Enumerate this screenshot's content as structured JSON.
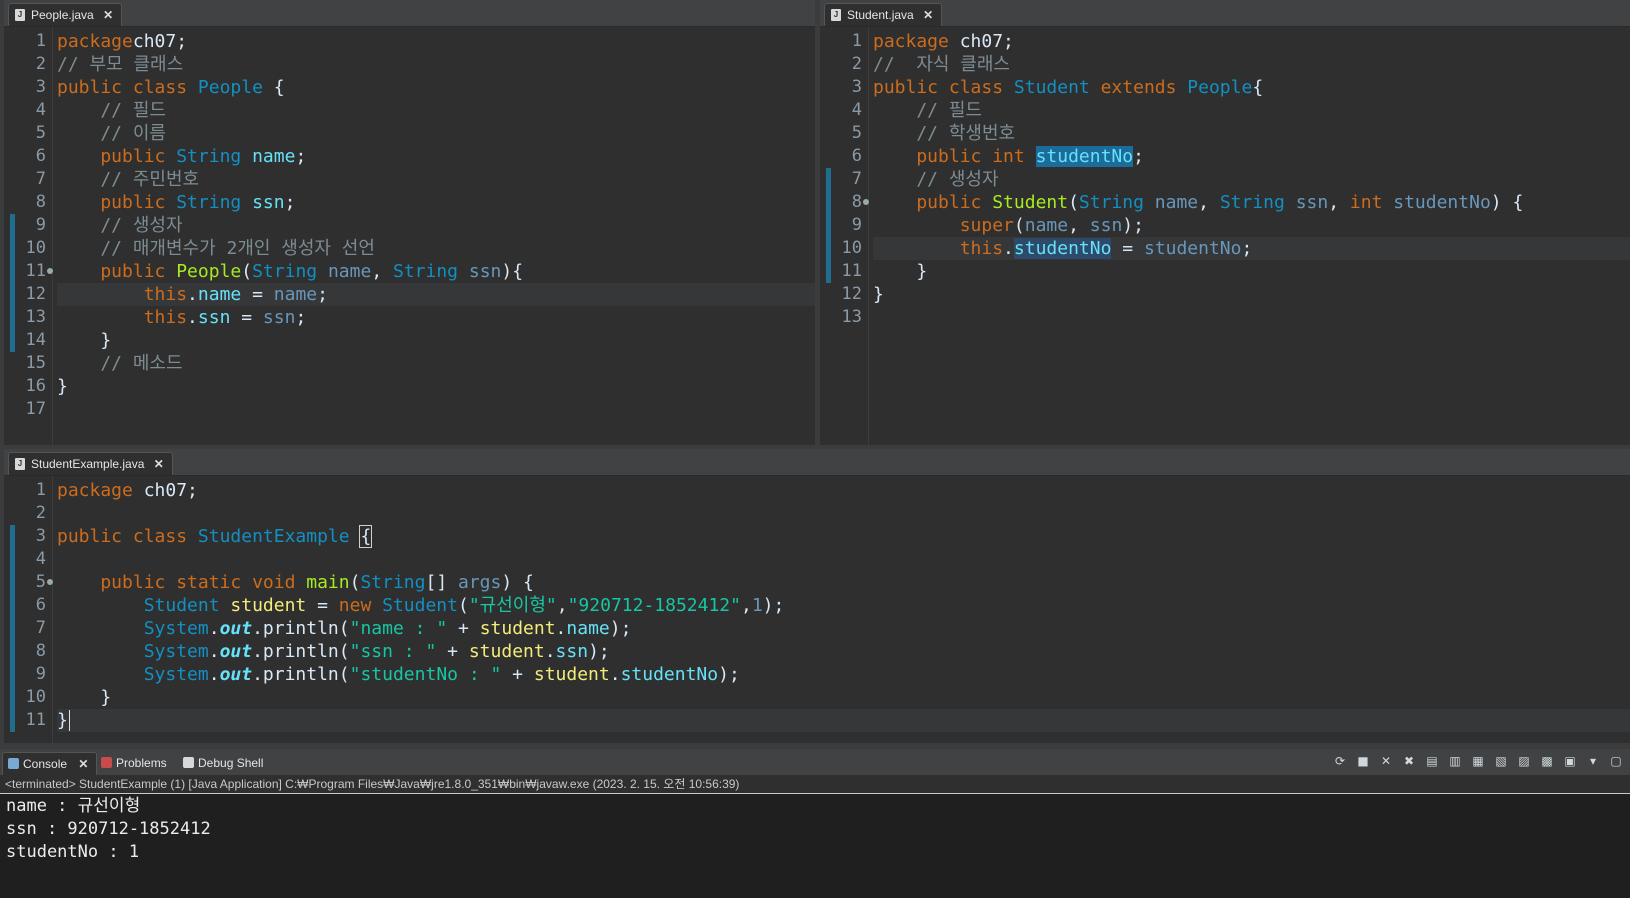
{
  "editors": {
    "people": {
      "tab_label": "People.java",
      "file_icon": "java-file-icon",
      "line_numbers": [
        "1",
        "2",
        "3",
        "4",
        "5",
        "6",
        "7",
        "8",
        "9",
        "10",
        "11",
        "12",
        "13",
        "14",
        "15",
        "16",
        "17"
      ]
    },
    "student": {
      "tab_label": "Student.java",
      "file_icon": "java-file-icon",
      "line_numbers": [
        "1",
        "2",
        "3",
        "4",
        "5",
        "6",
        "7",
        "8",
        "9",
        "10",
        "11",
        "12",
        "13"
      ]
    },
    "example": {
      "tab_label": "StudentExample.java",
      "file_icon": "java-file-icon",
      "line_numbers": [
        "1",
        "2",
        "3",
        "4",
        "5",
        "6",
        "7",
        "8",
        "9",
        "10",
        "11"
      ]
    }
  },
  "code": {
    "people": [
      [
        [
          "k",
          "package"
        ],
        [
          "",
          "ch07;"
        ]
      ],
      [
        [
          "c",
          "// 부모 클래스"
        ]
      ],
      [
        [
          "k",
          "public class "
        ],
        [
          "t",
          "People"
        ],
        [
          "",
          " {"
        ]
      ],
      [
        [
          "c",
          "    // 필드"
        ]
      ],
      [
        [
          "c",
          "    // 이름"
        ]
      ],
      [
        [
          "k",
          "    public "
        ],
        [
          "t",
          "String "
        ],
        [
          "f",
          "name"
        ],
        [
          "",
          ";"
        ]
      ],
      [
        [
          "c",
          "    // 주민번호"
        ]
      ],
      [
        [
          "k",
          "    public "
        ],
        [
          "t",
          "String "
        ],
        [
          "f",
          "ssn"
        ],
        [
          "",
          ";"
        ]
      ],
      [
        [
          "c",
          "    // 생성자"
        ]
      ],
      [
        [
          "c",
          "    // 매개변수가 2개인 생성자 선언"
        ]
      ],
      [
        [
          "k",
          "    public "
        ],
        [
          "m",
          "People"
        ],
        [
          "",
          "("
        ],
        [
          "t",
          "String "
        ],
        [
          "n",
          "name"
        ],
        [
          "",
          ", "
        ],
        [
          "t",
          "String "
        ],
        [
          "n",
          "ssn"
        ],
        [
          "",
          "){"
        ]
      ],
      [
        [
          "k",
          "        this"
        ],
        [
          "",
          "."
        ],
        [
          "f",
          "name"
        ],
        [
          "",
          " = "
        ],
        [
          "n",
          "name"
        ],
        [
          "",
          ";"
        ]
      ],
      [
        [
          "k",
          "        this"
        ],
        [
          "",
          "."
        ],
        [
          "f",
          "ssn"
        ],
        [
          "",
          " = "
        ],
        [
          "n",
          "ssn"
        ],
        [
          "",
          ";"
        ]
      ],
      [
        [
          "",
          "    }"
        ]
      ],
      [
        [
          "c",
          "    // 메소드"
        ]
      ],
      [
        [
          "",
          "}"
        ]
      ],
      [
        [
          "",
          ""
        ]
      ]
    ],
    "student": [
      [
        [
          "k",
          "package "
        ],
        [
          "",
          "ch07;"
        ]
      ],
      [
        [
          "c",
          "//  자식 클래스"
        ]
      ],
      [
        [
          "k",
          "public class "
        ],
        [
          "t",
          "Student "
        ],
        [
          "k",
          "extends "
        ],
        [
          "t",
          "People"
        ],
        [
          "",
          "{"
        ]
      ],
      [
        [
          "c",
          "    // 필드"
        ]
      ],
      [
        [
          "c",
          "    // 학생번호"
        ]
      ],
      [
        [
          "k",
          "    public int "
        ],
        [
          "fh",
          "studentNo"
        ],
        [
          "",
          ";"
        ]
      ],
      [
        [
          "c",
          "    // 생성자"
        ]
      ],
      [
        [
          "k",
          "    public "
        ],
        [
          "m",
          "Student"
        ],
        [
          "",
          "("
        ],
        [
          "t",
          "String "
        ],
        [
          "n",
          "name"
        ],
        [
          "",
          ", "
        ],
        [
          "t",
          "String "
        ],
        [
          "n",
          "ssn"
        ],
        [
          "",
          ", "
        ],
        [
          "k",
          "int "
        ],
        [
          "n",
          "studentNo"
        ],
        [
          "",
          ") {"
        ]
      ],
      [
        [
          "k",
          "        super"
        ],
        [
          "",
          "("
        ],
        [
          "n",
          "name"
        ],
        [
          "",
          ", "
        ],
        [
          "n",
          "ssn"
        ],
        [
          "",
          ");"
        ]
      ],
      [
        [
          "k",
          "        this"
        ],
        [
          "",
          "."
        ],
        [
          "fh2",
          "studentNo"
        ],
        [
          "",
          " = "
        ],
        [
          "n",
          "studentNo"
        ],
        [
          "",
          ";"
        ]
      ],
      [
        [
          "",
          "    }"
        ]
      ],
      [
        [
          "",
          "}"
        ]
      ],
      [
        [
          "",
          ""
        ]
      ]
    ],
    "example": [
      [
        [
          "k",
          "package "
        ],
        [
          "",
          "ch07;"
        ]
      ],
      [
        [
          "",
          ""
        ]
      ],
      [
        [
          "k",
          "public class "
        ],
        [
          "t",
          "StudentExample "
        ],
        [
          "b",
          "{"
        ]
      ],
      [
        [
          "",
          ""
        ]
      ],
      [
        [
          "k",
          "    public static void "
        ],
        [
          "m",
          "main"
        ],
        [
          "",
          "("
        ],
        [
          "t",
          "String"
        ],
        [
          "",
          "[] "
        ],
        [
          "n",
          "args"
        ],
        [
          "",
          ") {"
        ]
      ],
      [
        [
          "t",
          "        Student "
        ],
        [
          "v",
          "student"
        ],
        [
          "",
          " = "
        ],
        [
          "k",
          "new "
        ],
        [
          "t",
          "Student"
        ],
        [
          "",
          "("
        ],
        [
          "s",
          "\"규선이형\""
        ],
        [
          "",
          ","
        ],
        [
          "s",
          "\"920712-1852412\""
        ],
        [
          "",
          ","
        ],
        [
          "n",
          "1"
        ],
        [
          "",
          ");"
        ]
      ],
      [
        [
          "t",
          "        System"
        ],
        [
          "",
          "."
        ],
        [
          "fi",
          "out"
        ],
        [
          "",
          ".println("
        ],
        [
          "s",
          "\"name : \""
        ],
        [
          "",
          " + "
        ],
        [
          "v",
          "student"
        ],
        [
          "",
          "."
        ],
        [
          "f",
          "name"
        ],
        [
          "",
          ");"
        ]
      ],
      [
        [
          "t",
          "        System"
        ],
        [
          "",
          "."
        ],
        [
          "fi",
          "out"
        ],
        [
          "",
          ".println("
        ],
        [
          "s",
          "\"ssn : \""
        ],
        [
          "",
          " + "
        ],
        [
          "v",
          "student"
        ],
        [
          "",
          "."
        ],
        [
          "f",
          "ssn"
        ],
        [
          "",
          ");"
        ]
      ],
      [
        [
          "t",
          "        System"
        ],
        [
          "",
          "."
        ],
        [
          "fi",
          "out"
        ],
        [
          "",
          ".println("
        ],
        [
          "s",
          "\"studentNo : \""
        ],
        [
          "",
          " + "
        ],
        [
          "v",
          "student"
        ],
        [
          "",
          "."
        ],
        [
          "f",
          "studentNo"
        ],
        [
          "",
          ");"
        ]
      ],
      [
        [
          "",
          "    }"
        ]
      ],
      [
        [
          "",
          "}"
        ]
      ]
    ]
  },
  "console": {
    "tabs": [
      {
        "label": "Console",
        "icon": "console-icon"
      },
      {
        "label": "Problems",
        "icon": "problems-icon"
      },
      {
        "label": "Debug Shell",
        "icon": "debug-shell-icon"
      }
    ],
    "close_glyph": "✕",
    "status": "<terminated> StudentExample (1) [Java Application] C:₩Program Files₩Java₩jre1.8.0_351₩bin₩javaw.exe (2023. 2. 15. 오전 10:56:39)",
    "output": [
      "name : 규선이형",
      "ssn : 920712-1852412",
      "studentNo : 1"
    ],
    "toolbar_icons": [
      "sync-icon",
      "stop-icon",
      "remove-icon",
      "remove-all-icon",
      "copy-icon",
      "scroll-lock-icon",
      "word-wrap-icon",
      "pin-icon",
      "new-console-icon",
      "open-console-icon",
      "display-console-icon",
      "view-menu-icon",
      "new-window-icon"
    ]
  }
}
